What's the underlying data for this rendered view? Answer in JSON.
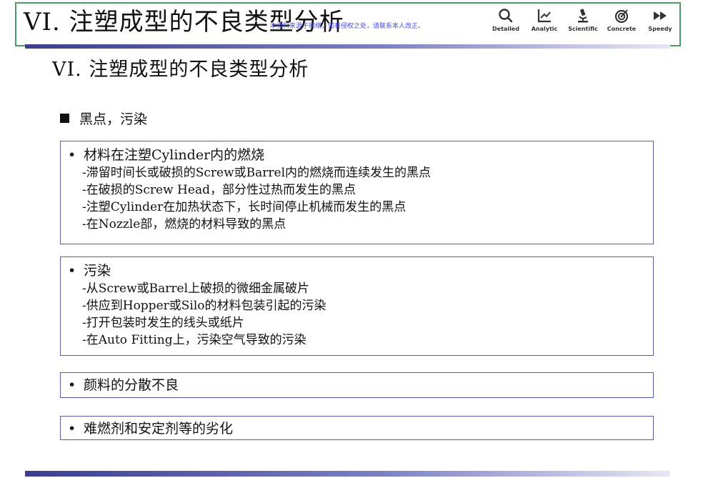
{
  "header": {
    "title": "VI. 注塑成型的不良类型分析",
    "watermark": "本资料来源于网络，如有侵权之处，请联系本人改正。",
    "icons": [
      {
        "icon": "magnifier-icon",
        "label": "Detailed"
      },
      {
        "icon": "line-chart-icon",
        "label": "Analytic"
      },
      {
        "icon": "microscope-icon",
        "label": "Scientific"
      },
      {
        "icon": "target-icon",
        "label": "Concrete"
      },
      {
        "icon": "fast-forward-icon",
        "label": "Speedy"
      }
    ]
  },
  "page_title": "VI. 注塑成型的不良类型分析",
  "section_heading": "黑点，污染",
  "boxes": [
    {
      "bullet": "材料在注塑Cylinder内的燃烧",
      "items": [
        "-滞留时间长或破损的Screw或Barrel内的燃烧而连续发生的黑点",
        "-在破损的Screw Head，部分性过热而发生的黑点",
        "-注塑Cylinder在加热状态下，长时间停止机械而发生的黑点",
        "-在Nozzle部，燃烧的材料导致的黑点"
      ]
    },
    {
      "bullet": "污染",
      "items": [
        "-从Screw或Barrel上破损的微细金属破片",
        "-供应到Hopper或Silo的材料包装引起的污染",
        "-打开包装时发生的线头或纸片",
        "-在Auto Fitting上，污染空气导致的污染"
      ]
    },
    {
      "bullet": "颜料的分散不良",
      "items": []
    },
    {
      "bullet": "难燃剂和安定剂等的劣化",
      "items": []
    }
  ],
  "colors": {
    "header_border": "#4d9a62",
    "rule_dark": "#3b3d8f",
    "box_border": "#5a5aa0",
    "watermark": "#4a4ae0"
  }
}
